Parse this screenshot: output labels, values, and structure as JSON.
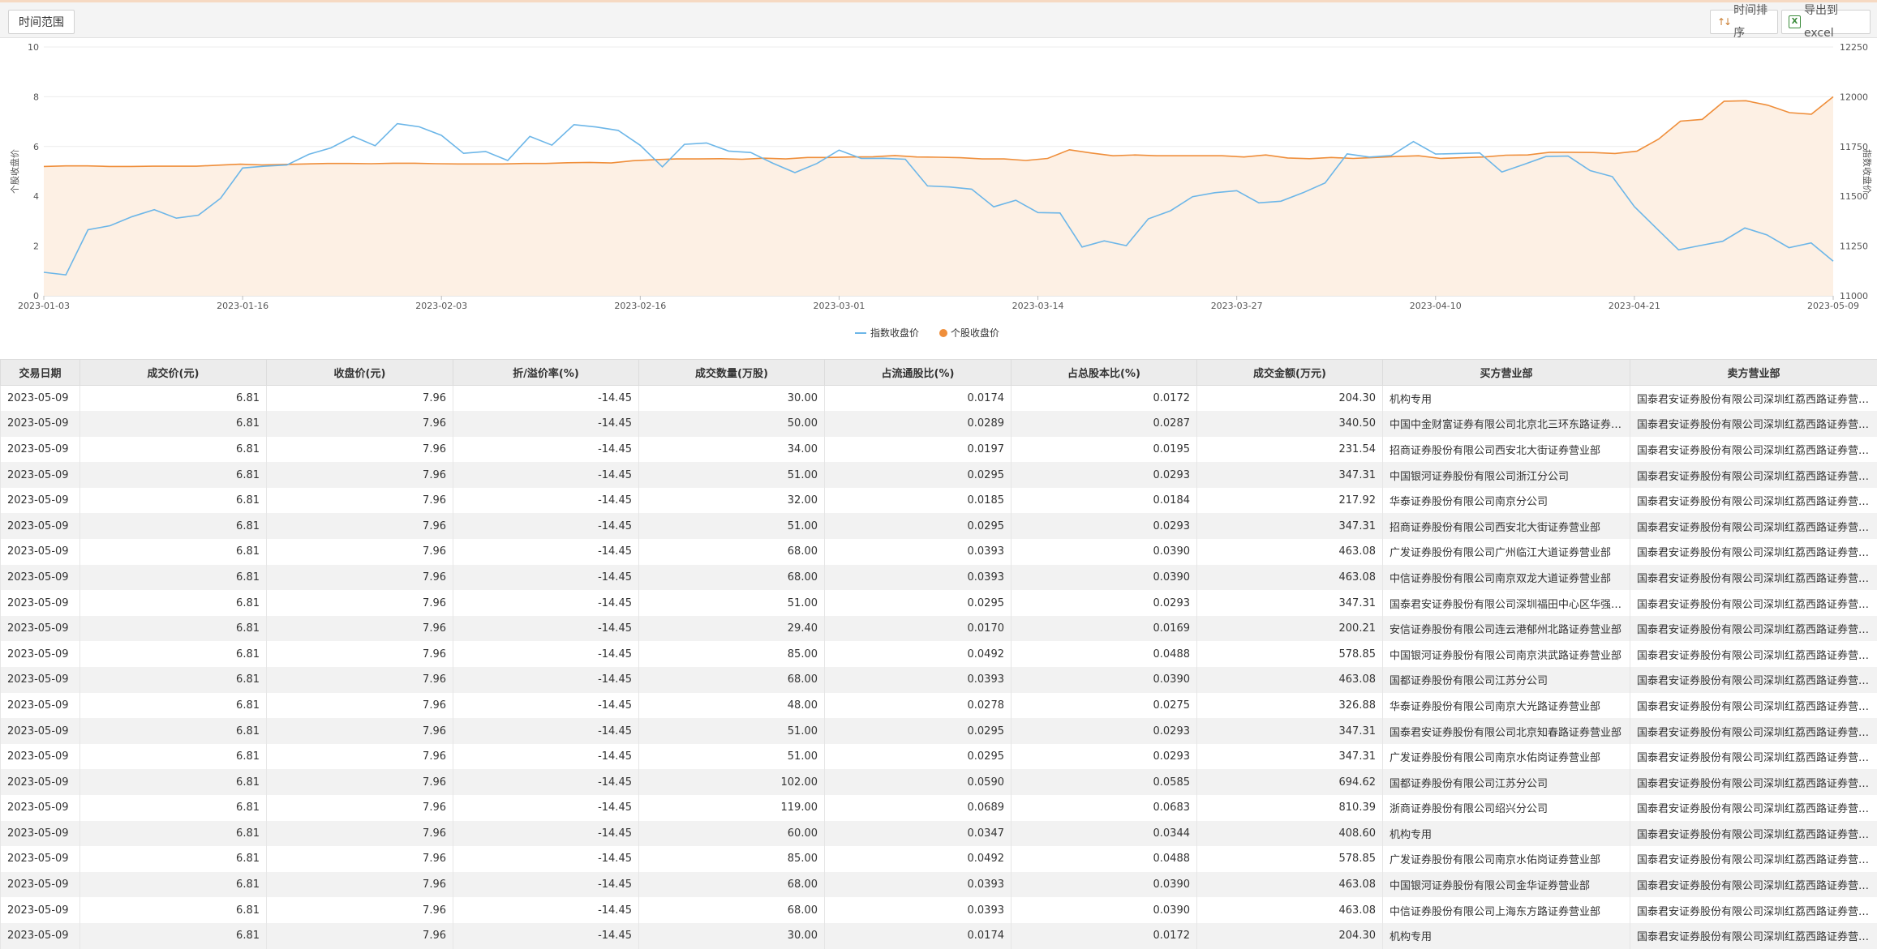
{
  "toolbar": {
    "range_label": "时间范围",
    "sort_label": "时间排序",
    "export_label": "导出到excel",
    "icons": {
      "sort": "sort-arrows-icon",
      "export": "excel-icon"
    }
  },
  "colors": {
    "index_line": "#6cb6e8",
    "stock_line": "#ef8e3a",
    "stock_fill": "#fdf0e4"
  },
  "chart_data": {
    "type": "line",
    "left_axis": {
      "label": "个股收盘价",
      "range": [
        0,
        10
      ],
      "ticks": [
        0,
        2,
        4,
        6,
        8,
        10
      ]
    },
    "right_axis": {
      "label": "指数收盘价",
      "range": [
        11000,
        12250
      ],
      "ticks": [
        11000,
        11250,
        11500,
        11750,
        12000,
        12250
      ]
    },
    "x_tick_labels": [
      "2023-01-03",
      "2023-01-16",
      "2023-02-03",
      "2023-02-16",
      "2023-03-01",
      "2023-03-14",
      "2023-03-27",
      "2023-04-10",
      "2023-04-21",
      "2023-05-09"
    ],
    "grid": true,
    "legend_position": "bottom",
    "series": [
      {
        "name": "指数收盘价",
        "axis": "right",
        "values": [
          11118,
          11105,
          11332,
          11352,
          11398,
          11433,
          11390,
          11405,
          11490,
          11642,
          11651,
          11657,
          11711,
          11743,
          11801,
          11754,
          11865,
          11849,
          11806,
          11716,
          11725,
          11680,
          11801,
          11757,
          11860,
          11848,
          11831,
          11756,
          11648,
          11761,
          11768,
          11727,
          11720,
          11666,
          11619,
          11665,
          11732,
          11690,
          11691,
          11686,
          11552,
          11547,
          11536,
          11447,
          11480,
          11418,
          11416,
          11245,
          11276,
          11252,
          11387,
          11427,
          11498,
          11518,
          11528,
          11467,
          11475,
          11518,
          11567,
          11713,
          11697,
          11705,
          11775,
          11712,
          11715,
          11718,
          11622,
          11660,
          11700,
          11702,
          11629,
          11599,
          11448,
          11339,
          11231,
          11253,
          11274,
          11341,
          11306,
          11242,
          11266,
          11174
        ],
        "line_style": "no-fill"
      },
      {
        "name": "个股收盘价",
        "axis": "left",
        "values": [
          5.2,
          5.22,
          5.22,
          5.2,
          5.2,
          5.21,
          5.21,
          5.21,
          5.25,
          5.29,
          5.26,
          5.28,
          5.3,
          5.32,
          5.32,
          5.31,
          5.33,
          5.33,
          5.31,
          5.3,
          5.3,
          5.3,
          5.32,
          5.32,
          5.35,
          5.36,
          5.34,
          5.43,
          5.47,
          5.5,
          5.5,
          5.51,
          5.49,
          5.53,
          5.5,
          5.56,
          5.56,
          5.58,
          5.59,
          5.64,
          5.58,
          5.57,
          5.55,
          5.5,
          5.5,
          5.44,
          5.52,
          5.87,
          5.74,
          5.63,
          5.66,
          5.63,
          5.63,
          5.63,
          5.63,
          5.58,
          5.66,
          5.54,
          5.51,
          5.56,
          5.52,
          5.56,
          5.6,
          5.63,
          5.52,
          5.55,
          5.58,
          5.65,
          5.66,
          5.77,
          5.77,
          5.76,
          5.72,
          5.81,
          6.3,
          7.02,
          7.09,
          7.82,
          7.84,
          7.66,
          7.36,
          7.3,
          8.0
        ],
        "line_style": "area"
      }
    ]
  },
  "table": {
    "columns": [
      "交易日期",
      "成交价(元)",
      "收盘价(元)",
      "折/溢价率(%)",
      "成交数量(万股)",
      "占流通股比(%)",
      "占总股本比(%)",
      "成交金额(万元)",
      "买方营业部",
      "卖方营业部"
    ],
    "rows": [
      [
        "2023-05-09",
        "6.81",
        "7.96",
        "-14.45",
        "30.00",
        "0.0174",
        "0.0172",
        "204.30",
        "机构专用",
        "国泰君安证券股份有限公司深圳红荔西路证券营业部"
      ],
      [
        "2023-05-09",
        "6.81",
        "7.96",
        "-14.45",
        "50.00",
        "0.0289",
        "0.0287",
        "340.50",
        "中国中金财富证券有限公司北京北三环东路证券营业部",
        "国泰君安证券股份有限公司深圳红荔西路证券营业部"
      ],
      [
        "2023-05-09",
        "6.81",
        "7.96",
        "-14.45",
        "34.00",
        "0.0197",
        "0.0195",
        "231.54",
        "招商证券股份有限公司西安北大街证券营业部",
        "国泰君安证券股份有限公司深圳红荔西路证券营业部"
      ],
      [
        "2023-05-09",
        "6.81",
        "7.96",
        "-14.45",
        "51.00",
        "0.0295",
        "0.0293",
        "347.31",
        "中国银河证券股份有限公司浙江分公司",
        "国泰君安证券股份有限公司深圳红荔西路证券营业部"
      ],
      [
        "2023-05-09",
        "6.81",
        "7.96",
        "-14.45",
        "32.00",
        "0.0185",
        "0.0184",
        "217.92",
        "华泰证券股份有限公司南京分公司",
        "国泰君安证券股份有限公司深圳红荔西路证券营业部"
      ],
      [
        "2023-05-09",
        "6.81",
        "7.96",
        "-14.45",
        "51.00",
        "0.0295",
        "0.0293",
        "347.31",
        "招商证券股份有限公司西安北大街证券营业部",
        "国泰君安证券股份有限公司深圳红荔西路证券营业部"
      ],
      [
        "2023-05-09",
        "6.81",
        "7.96",
        "-14.45",
        "68.00",
        "0.0393",
        "0.0390",
        "463.08",
        "广发证券股份有限公司广州临江大道证券营业部",
        "国泰君安证券股份有限公司深圳红荔西路证券营业部"
      ],
      [
        "2023-05-09",
        "6.81",
        "7.96",
        "-14.45",
        "68.00",
        "0.0393",
        "0.0390",
        "463.08",
        "中信证券股份有限公司南京双龙大道证券营业部",
        "国泰君安证券股份有限公司深圳红荔西路证券营业部"
      ],
      [
        "2023-05-09",
        "6.81",
        "7.96",
        "-14.45",
        "51.00",
        "0.0295",
        "0.0293",
        "347.31",
        "国泰君安证券股份有限公司深圳福田中心区华强北证券营业部",
        "国泰君安证券股份有限公司深圳红荔西路证券营业部"
      ],
      [
        "2023-05-09",
        "6.81",
        "7.96",
        "-14.45",
        "29.40",
        "0.0170",
        "0.0169",
        "200.21",
        "安信证券股份有限公司连云港郁州北路证券营业部",
        "国泰君安证券股份有限公司深圳红荔西路证券营业部"
      ],
      [
        "2023-05-09",
        "6.81",
        "7.96",
        "-14.45",
        "85.00",
        "0.0492",
        "0.0488",
        "578.85",
        "中国银河证券股份有限公司南京洪武路证券营业部",
        "国泰君安证券股份有限公司深圳红荔西路证券营业部"
      ],
      [
        "2023-05-09",
        "6.81",
        "7.96",
        "-14.45",
        "68.00",
        "0.0393",
        "0.0390",
        "463.08",
        "国都证券股份有限公司江苏分公司",
        "国泰君安证券股份有限公司深圳红荔西路证券营业部"
      ],
      [
        "2023-05-09",
        "6.81",
        "7.96",
        "-14.45",
        "48.00",
        "0.0278",
        "0.0275",
        "326.88",
        "华泰证券股份有限公司南京大光路证券营业部",
        "国泰君安证券股份有限公司深圳红荔西路证券营业部"
      ],
      [
        "2023-05-09",
        "6.81",
        "7.96",
        "-14.45",
        "51.00",
        "0.0295",
        "0.0293",
        "347.31",
        "国泰君安证券股份有限公司北京知春路证券营业部",
        "国泰君安证券股份有限公司深圳红荔西路证券营业部"
      ],
      [
        "2023-05-09",
        "6.81",
        "7.96",
        "-14.45",
        "51.00",
        "0.0295",
        "0.0293",
        "347.31",
        "广发证券股份有限公司南京水佑岗证券营业部",
        "国泰君安证券股份有限公司深圳红荔西路证券营业部"
      ],
      [
        "2023-05-09",
        "6.81",
        "7.96",
        "-14.45",
        "102.00",
        "0.0590",
        "0.0585",
        "694.62",
        "国都证券股份有限公司江苏分公司",
        "国泰君安证券股份有限公司深圳红荔西路证券营业部"
      ],
      [
        "2023-05-09",
        "6.81",
        "7.96",
        "-14.45",
        "119.00",
        "0.0689",
        "0.0683",
        "810.39",
        "浙商证券股份有限公司绍兴分公司",
        "国泰君安证券股份有限公司深圳红荔西路证券营业部"
      ],
      [
        "2023-05-09",
        "6.81",
        "7.96",
        "-14.45",
        "60.00",
        "0.0347",
        "0.0344",
        "408.60",
        "机构专用",
        "国泰君安证券股份有限公司深圳红荔西路证券营业部"
      ],
      [
        "2023-05-09",
        "6.81",
        "7.96",
        "-14.45",
        "85.00",
        "0.0492",
        "0.0488",
        "578.85",
        "广发证券股份有限公司南京水佑岗证券营业部",
        "国泰君安证券股份有限公司深圳红荔西路证券营业部"
      ],
      [
        "2023-05-09",
        "6.81",
        "7.96",
        "-14.45",
        "68.00",
        "0.0393",
        "0.0390",
        "463.08",
        "中国银河证券股份有限公司金华证券营业部",
        "国泰君安证券股份有限公司深圳红荔西路证券营业部"
      ],
      [
        "2023-05-09",
        "6.81",
        "7.96",
        "-14.45",
        "68.00",
        "0.0393",
        "0.0390",
        "463.08",
        "中信证券股份有限公司上海东方路证券营业部",
        "国泰君安证券股份有限公司深圳红荔西路证券营业部"
      ],
      [
        "2023-05-09",
        "6.81",
        "7.96",
        "-14.45",
        "30.00",
        "0.0174",
        "0.0172",
        "204.30",
        "机构专用",
        "国泰君安证券股份有限公司深圳红荔西路证券营业部"
      ]
    ]
  }
}
